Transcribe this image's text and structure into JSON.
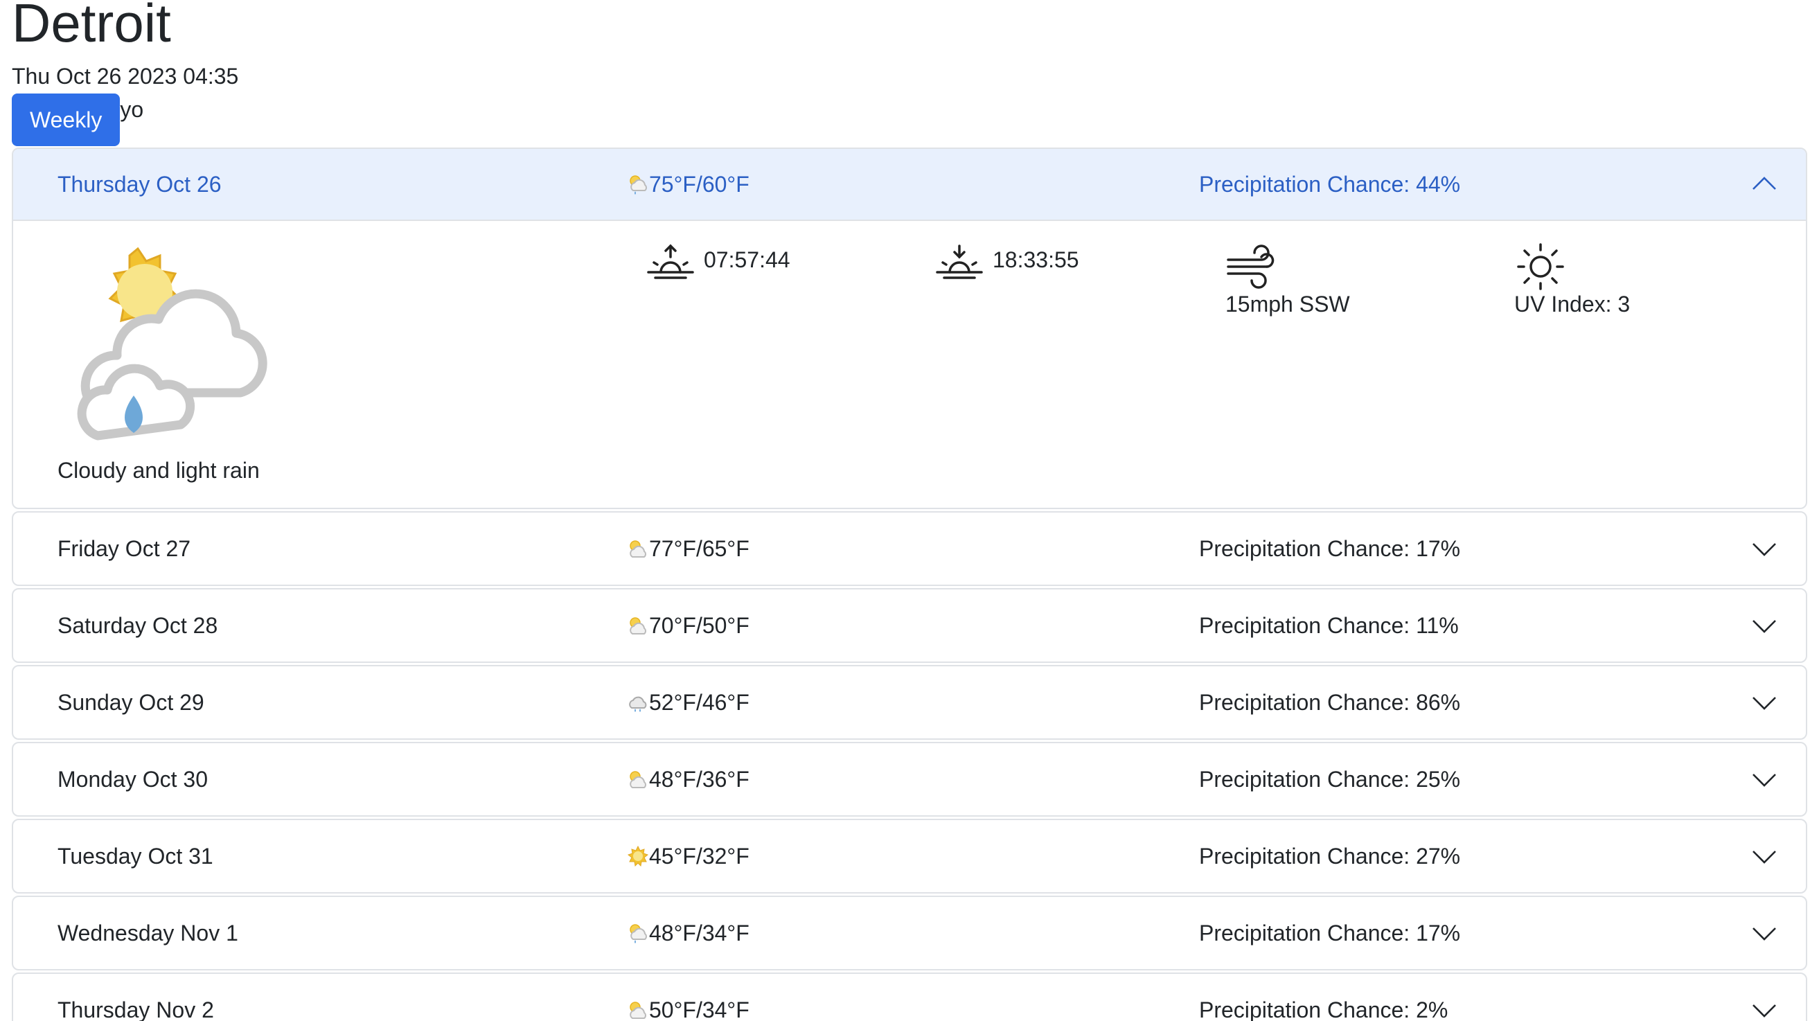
{
  "city": "Detroit",
  "datetime": "Thu Oct 26 2023 04:35",
  "toggle": {
    "weekly_label": "Weekly",
    "other_text": "yo"
  },
  "colors": {
    "accent": "#2f6fe8",
    "open_header_bg": "#e8f0fd",
    "open_header_text": "#2b5fc4"
  },
  "days": [
    {
      "day": "Thursday Oct 26",
      "temps": "75°F/60°F",
      "precip": "Precipitation Chance: 44%",
      "icon": "partly-cloudy-rain-icon",
      "open": true
    },
    {
      "day": "Friday Oct 27",
      "temps": "77°F/65°F",
      "precip": "Precipitation Chance: 17%",
      "icon": "partly-cloudy-icon",
      "open": false
    },
    {
      "day": "Saturday Oct 28",
      "temps": "70°F/50°F",
      "precip": "Precipitation Chance: 11%",
      "icon": "partly-cloudy-icon",
      "open": false
    },
    {
      "day": "Sunday Oct 29",
      "temps": "52°F/46°F",
      "precip": "Precipitation Chance: 86%",
      "icon": "rain-cloud-icon",
      "open": false
    },
    {
      "day": "Monday Oct 30",
      "temps": "48°F/36°F",
      "precip": "Precipitation Chance: 25%",
      "icon": "partly-cloudy-icon",
      "open": false
    },
    {
      "day": "Tuesday Oct 31",
      "temps": "45°F/32°F",
      "precip": "Precipitation Chance: 27%",
      "icon": "sun-icon",
      "open": false
    },
    {
      "day": "Wednesday Nov 1",
      "temps": "48°F/34°F",
      "precip": "Precipitation Chance: 17%",
      "icon": "partly-cloudy-rain-icon",
      "open": false
    },
    {
      "day": "Thursday Nov 2",
      "temps": "50°F/34°F",
      "precip": "Precipitation Chance: 2%",
      "icon": "partly-cloudy-icon",
      "open": false
    }
  ],
  "details": {
    "description": "Cloudy and light rain",
    "sunrise": "07:57:44",
    "sunset": "18:33:55",
    "wind": "15mph SSW",
    "uv": "UV Index: 3",
    "icons": {
      "weather": "partly-cloudy-rain-icon",
      "sunrise": "sunrise-icon",
      "sunset": "sunset-icon",
      "wind": "wind-icon",
      "uv": "uv-sun-icon"
    }
  }
}
